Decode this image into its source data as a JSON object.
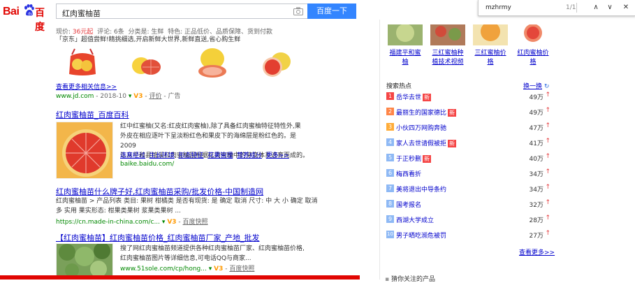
{
  "header": {
    "logo_left": "Bai",
    "logo_right": "百度",
    "query": "红肉蜜柚苗",
    "search_button": "百度一下"
  },
  "findbar": {
    "term": "mzhrmy",
    "count": "1/1",
    "up": "∧",
    "down": "∨",
    "close": "✕"
  },
  "result1": {
    "price_label": "现价:",
    "price": "36元起",
    "reviews": "评论: 6条",
    "category": "分类是: 生鲜",
    "features": "特色: 正品低价、品质保障、货到付款",
    "promo": "「京东」超值尝鲜!精挑细选,开启新鲜大世界,新鲜直送,省心购生鲜",
    "more_link": "查看更多相关信息>>",
    "url": "www.jd.com",
    "date": "2018-10",
    "v3": "V3",
    "eval": "评价",
    "ad": "广告"
  },
  "result2": {
    "title": "红肉蜜柚苗_百度百科",
    "snippet_lines": [
      "红中红蜜柚(又名:红皮红肉蜜柚),除了具备红肉蜜柚特征特性外,果",
      "外皮在相应逐叶下呈淡粉红色和果皮下的海绵层是粉红色的。是2009",
      "年从平和县琯溪红肉蜜柚园根据红肉蜜柚中的芽变体系选育而成的。"
    ],
    "sublinks": [
      "选育经过",
      "生长环境",
      "形态特征",
      "花果管理",
      "营养成分",
      "更多>>"
    ],
    "url": "baike.baidu.com/"
  },
  "result3": {
    "title": "红肉蜜柚苗什么牌子好,红肉蜜柚苗采购/批发价格-中国制造网",
    "snippet_lines": [
      "红肉蜜柚苗 > 产品列表 类目: 果树 柑橘类 是否有现货: 是 确定 取消 尺寸: 中 大 小 确定 取消",
      "多 实用 果实形态: 柑果类果树 浆果类果树 ..."
    ],
    "url": "https://cn.made-in-china.com/c...",
    "v3": "V3",
    "snapshot": "百度快照"
  },
  "result4": {
    "title": "【红肉蜜柚苗】红肉蜜柚苗价格_红肉蜜柚苗厂家_产地_批发",
    "snippet_lines": [
      "搜了网红肉蜜柚苗频道提供各种红肉蜜柚苗厂家、红肉蜜柚苗价格,",
      "红肉蜜柚苗图片等详细信息,可电话QQ与商家..."
    ],
    "url": "www.51sole.com/cp/hong...",
    "v3": "V3",
    "snapshot": "百度快照"
  },
  "sidebar": {
    "captions": [
      [
        "福建平和蜜",
        "柚"
      ],
      [
        "三红蜜柚种",
        "植技术视频"
      ],
      [
        "三红蜜柚价",
        "格"
      ],
      [
        "红肉蜜柚价",
        "格"
      ]
    ],
    "hot_title": "搜索热点",
    "refresh": "换一换",
    "hot": [
      {
        "rank": "1",
        "text": "岳华去世",
        "new": "新",
        "count": "49万"
      },
      {
        "rank": "2",
        "text": "最丽生的国家德比",
        "new": "新",
        "count": "49万"
      },
      {
        "rank": "3",
        "text": "小伙四万网购奔驰",
        "new": "",
        "count": "47万"
      },
      {
        "rank": "4",
        "text": "家人去世请假被拒",
        "new": "新",
        "count": "41万"
      },
      {
        "rank": "5",
        "text": "于正秒删",
        "new": "新",
        "count": "40万"
      },
      {
        "rank": "6",
        "text": "梅西看折",
        "new": "",
        "count": "34万"
      },
      {
        "rank": "7",
        "text": "美将退出中导条约",
        "new": "",
        "count": "34万"
      },
      {
        "rank": "8",
        "text": "国考报名",
        "new": "",
        "count": "32万"
      },
      {
        "rank": "9",
        "text": "西湖大学成立",
        "new": "",
        "count": "28万"
      },
      {
        "rank": "10",
        "text": "男子晒吃濒危被罚",
        "new": "",
        "count": "27万"
      }
    ],
    "more": "查看更多>>",
    "bottom": "猜你关注的产品"
  },
  "colors": {
    "brand": "#e10602",
    "link": "#00c",
    "button": "#3385ff"
  }
}
